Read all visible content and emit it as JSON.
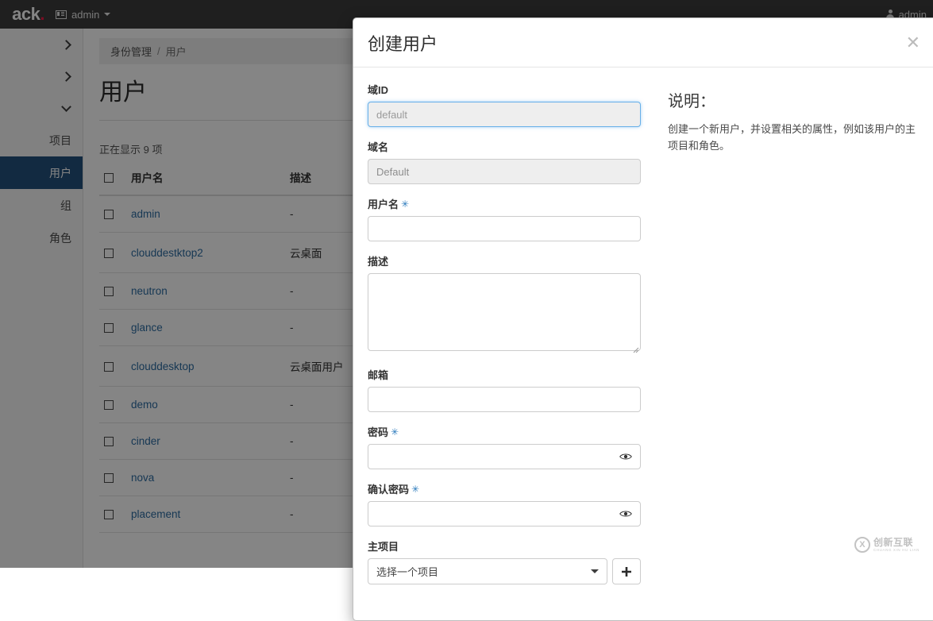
{
  "navbar": {
    "brand": "ack",
    "brand_dot": ".",
    "context_label": "admin",
    "context_icon": "list-icon",
    "user_label": "admin",
    "user_icon": "user-icon"
  },
  "sidebar": {
    "toggles": [
      {
        "icon": "chevron-right-icon"
      },
      {
        "icon": "chevron-right-icon"
      },
      {
        "icon": "chevron-down-icon"
      }
    ],
    "items": [
      {
        "label": "项目",
        "active": false
      },
      {
        "label": "用户",
        "active": true
      },
      {
        "label": "组",
        "active": false
      },
      {
        "label": "角色",
        "active": false
      }
    ],
    "active_color": "#23517e"
  },
  "page": {
    "breadcrumb": {
      "parent": "身份管理",
      "separator": "/",
      "current": "用户"
    },
    "title": "用户",
    "count_text": "正在显示 9 项"
  },
  "table": {
    "columns": [
      "用户名",
      "描述"
    ],
    "rows": [
      {
        "name": "admin",
        "description": "-"
      },
      {
        "name": "clouddestktop2",
        "description": "云桌面"
      },
      {
        "name": "neutron",
        "description": "-"
      },
      {
        "name": "glance",
        "description": "-"
      },
      {
        "name": "clouddesktop",
        "description": "云桌面用户"
      },
      {
        "name": "demo",
        "description": "-"
      },
      {
        "name": "cinder",
        "description": "-"
      },
      {
        "name": "nova",
        "description": "-"
      },
      {
        "name": "placement",
        "description": "-"
      }
    ]
  },
  "modal": {
    "title": "创建用户",
    "close_label": "✕",
    "fields": {
      "domain_id": {
        "label": "域ID",
        "placeholder": "default",
        "value": "",
        "state": "focused"
      },
      "domain_name": {
        "label": "域名",
        "value": "Default",
        "state": "disabled"
      },
      "user_name": {
        "label": "用户名",
        "required": true,
        "required_mark": "✳",
        "value": ""
      },
      "description": {
        "label": "描述",
        "value": ""
      },
      "email": {
        "label": "邮箱",
        "value": ""
      },
      "password": {
        "label": "密码",
        "required": true,
        "required_mark": "✳",
        "value": "",
        "toggle_icon": "eye-icon"
      },
      "confirm_password": {
        "label": "确认密码",
        "required": true,
        "required_mark": "✳",
        "value": "",
        "toggle_icon": "eye-icon"
      },
      "primary_project": {
        "label": "主项目",
        "selected": "选择一个项目",
        "add_label": "+"
      }
    },
    "help": {
      "title": "说明：",
      "text": "创建一个新用户，并设置相关的属性，例如该用户的主项目和角色。"
    }
  },
  "watermark": {
    "logo": "X",
    "cn": "创新互联",
    "en": "CHUANG XIN HU LIAN"
  }
}
